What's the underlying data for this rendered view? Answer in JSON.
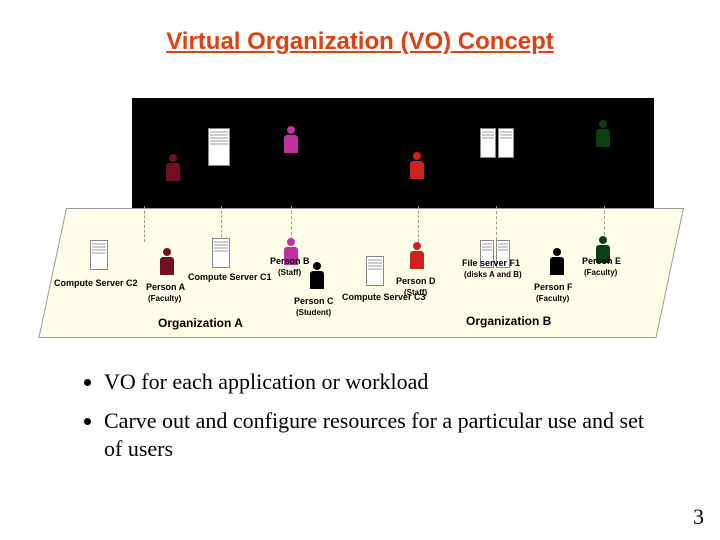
{
  "title": "Virtual Organization (VO) Concept",
  "diagram": {
    "orgA": {
      "label": "Organization A",
      "persons": {
        "A": {
          "name": "Person A",
          "role": "(Faculty)"
        },
        "B": {
          "name": "Person B",
          "role": "(Staff)"
        },
        "C": {
          "name": "Person C",
          "role": "(Student)"
        }
      },
      "servers": {
        "C1": "Compute Server C1",
        "C2": "Compute Server C2"
      }
    },
    "orgB": {
      "label": "Organization B",
      "persons": {
        "D": {
          "name": "Person D",
          "role": "(Staff)"
        },
        "E": {
          "name": "Person E",
          "role": "(Faculty)"
        },
        "F": {
          "name": "Person F",
          "role": "(Faculty)"
        }
      },
      "servers": {
        "C3": "Compute Server C3",
        "F1": {
          "name": "File server F1",
          "sub": "(disks A and B)"
        }
      }
    }
  },
  "bullets": [
    "VO for each application or workload",
    "Carve out and configure resources for a particular use and set of users"
  ],
  "page_number": "3"
}
